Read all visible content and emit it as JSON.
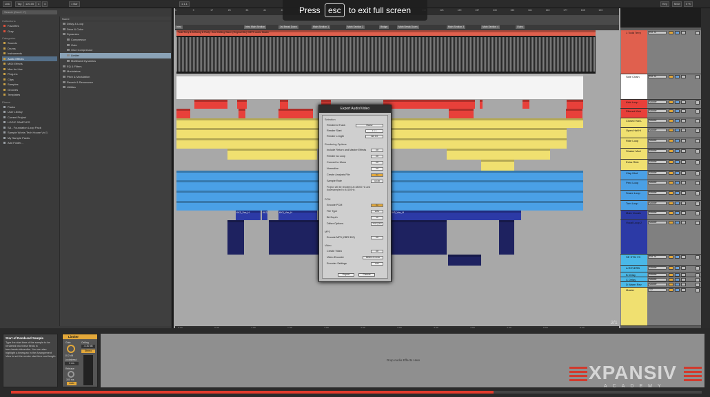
{
  "topbar": {
    "link_label": "Link",
    "tap_label": "Tap",
    "tempo": "120.00",
    "time_sig_num": "4",
    "time_sig_den": "4",
    "quantize": "1 Bar",
    "key_label": "Key",
    "midi_label": "MIDI",
    "cpu": "0 %",
    "position": "1.1.1",
    "end_label": "4.0.0"
  },
  "overlay": {
    "press": "Press",
    "key": "esc",
    "message": "to exit full screen"
  },
  "browser": {
    "search_placeholder": "Search (Cmd + F)",
    "collections_label": "Collections",
    "collections": [
      "Favorites",
      "Gray"
    ],
    "categories_label": "Categories",
    "categories": [
      "Sounds",
      "Drums",
      "Instruments",
      "Audio Effects",
      "MIDI Effects",
      "Max for Live",
      "Plug-ins",
      "Clips",
      "Samples",
      "Grooves",
      "Templates"
    ],
    "places_label": "Places",
    "places": [
      "Packs",
      "User Library",
      "Current Project",
      "LOGIC SAMPLES",
      "SA - Foundation Loop Pack",
      "Sample Works Tech House Vol.1",
      "My Sample Packs",
      "Add Folder..."
    ],
    "files_header": "Name",
    "files": [
      "Delay & Loop",
      "Drive & Color",
      "Dynamics",
      "Compressor",
      "Gate",
      "Glue Compressor",
      "Limiter",
      "Multiband Dynamics",
      "EQ & Filters",
      "Modulators",
      "Pitch & Modulation",
      "Reverb & Resonance",
      "Utilities"
    ]
  },
  "arrangement": {
    "ruler_ticks": [
      "1",
      "9",
      "17",
      "25",
      "33",
      "41",
      "49",
      "57",
      "65",
      "73",
      "81",
      "89",
      "97",
      "105",
      "113",
      "121",
      "129",
      "137",
      "145",
      "153",
      "161",
      "169",
      "177",
      "185",
      "193"
    ],
    "locators": [
      "Intro",
      "Intro Main Section",
      "1st Break Down",
      "Main Section 1",
      "Main Section 2",
      "Bridge",
      "Main Break Down",
      "Main Section 3",
      "Main Section 4",
      "Outro"
    ],
    "audio_clip_name": "Todd Terry & Jeffoeng & Rudy - Just Getting Warm (Original Mix) XMPN audio Master",
    "vocal_clip_label": "KK3_Voc_H",
    "time_ticks": [
      "0:00",
      "0:30",
      "1:00",
      "1:30",
      "2:00",
      "2:30",
      "3:00",
      "3:30",
      "4:00",
      "4:30",
      "5:00",
      "5:30"
    ],
    "zoom_label": "2/1"
  },
  "tracks": [
    {
      "name": "1 Todd Terry",
      "io": "Ext. In",
      "color": "#e0604e"
    },
    {
      "name": "Side Chain",
      "io": "Ext. In",
      "color": "#ffffff"
    },
    {
      "name": "Kick Loop",
      "io": "Master",
      "color": "#e8403a"
    },
    {
      "name": "Filtered Kick",
      "io": "Master",
      "color": "#e8403a"
    },
    {
      "name": "Closed Hat L",
      "io": "Master",
      "color": "#f0e070"
    },
    {
      "name": "Open Hat Hi",
      "io": "Master",
      "color": "#f0e070"
    },
    {
      "name": "Ride Loop",
      "io": "Master",
      "color": "#f0e070"
    },
    {
      "name": "Shaker Mod",
      "io": "Master",
      "color": "#f0e070"
    },
    {
      "name": "Extra Ride",
      "io": "Master",
      "color": "#f0e070"
    },
    {
      "name": "Clap Mod",
      "io": "Master",
      "color": "#4aa0e6"
    },
    {
      "name": "Perc Loop",
      "io": "Master",
      "color": "#4aa0e6"
    },
    {
      "name": "Snare Loop",
      "io": "Master",
      "color": "#4aa0e6"
    },
    {
      "name": "Tom Loop",
      "io": "Master",
      "color": "#4aa0e6"
    },
    {
      "name": "Main Vocals",
      "io": "Master",
      "color": "#2c3aa6"
    },
    {
      "name": "Vocal Loop 2",
      "io": "Master",
      "color": "#2c3aa6"
    },
    {
      "name": "SE STM V3",
      "io": "Ext. In",
      "color": "#4ab8e8"
    },
    {
      "name": "A REVERB",
      "io": "Master",
      "color": "#4ab8e8"
    },
    {
      "name": "B Delay",
      "io": "Master",
      "color": "#4ab8e8"
    },
    {
      "name": "C Delay",
      "io": "Master",
      "color": "#4ab8e8"
    },
    {
      "name": "D Warm Rev",
      "io": "Master",
      "color": "#4ab8e8"
    },
    {
      "name": "Master",
      "io": "1/2",
      "color": "#f0e070"
    }
  ],
  "dialog": {
    "title": "Export Audio/Video",
    "selection_label": "Selection",
    "rendered_track_label": "Rendered Track",
    "rendered_track_value": "Master",
    "render_start_label": "Render Start",
    "render_start_value": "1 1 1",
    "render_length_label": "Render Length",
    "render_length_value": "190 0 0",
    "rendering_options_label": "Rendering Options",
    "include_return_label": "Include Return and Master Effects",
    "include_return_value": "Off",
    "render_loop_label": "Render as Loop",
    "render_loop_value": "Off",
    "convert_mono_label": "Convert to Mono",
    "convert_mono_value": "Off",
    "normalize_label": "Normalize",
    "normalize_value": "Off",
    "analysis_label": "Create Analysis File",
    "analysis_value": "On",
    "sample_rate_label": "Sample Rate",
    "sample_rate_value": "44100",
    "note": "Project will be rendered at 48000 Hz and downsampled to 44100Hz.",
    "pcm_label": "PCM",
    "encode_pcm_label": "Encode PCM",
    "encode_pcm_value": "On",
    "file_type_label": "File Type",
    "file_type_value": "WAV",
    "bit_depth_label": "Bit Depth",
    "bit_depth_value": "16",
    "dither_label": "Dither Options",
    "dither_value": "Triangular",
    "mp3_label": "MP3",
    "encode_mp3_label": "Encode MP3 (CBR 320)",
    "encode_mp3_value": "Off",
    "video_label": "Video",
    "create_video_label": "Create Video",
    "create_video_value": "Off",
    "video_encoder_label": "Video Encoder",
    "video_encoder_value": "MPEG-4 movie",
    "encoder_settings_label": "Encoder Settings",
    "encoder_settings_value": "Edit",
    "export_label": "Export",
    "cancel_label": "Cancel"
  },
  "bottom": {
    "info_title": "Start of Rendered Sample",
    "info_text": "Type the start time of the sample to be rendered into these fields in bars.beats.sixteenths. You can also highlight a timespan in the Arrangement View to set the render start time and length.",
    "device_name": "Limiter",
    "gain_label": "Gain",
    "ceiling_label": "Ceiling",
    "ceiling_value": "-0.30 dB",
    "gain_value": "10.2 dB",
    "lookahead_label": "Lookahead",
    "lookahead_value": "3 ms",
    "release_label": "Release",
    "release_value": "300 ms",
    "auto_label": "Auto",
    "stereo_label": "Stereo",
    "drop_text": "Drop Audio Effects Here"
  },
  "logo": {
    "brand": "XPANSIV",
    "sub": "ACADEMY"
  },
  "colors": {
    "kick": "#e8403a",
    "hats": "#f0e070",
    "perc": "#4aa0e6",
    "vocal": "#2c3aa6",
    "progress": "#e23b2c"
  }
}
